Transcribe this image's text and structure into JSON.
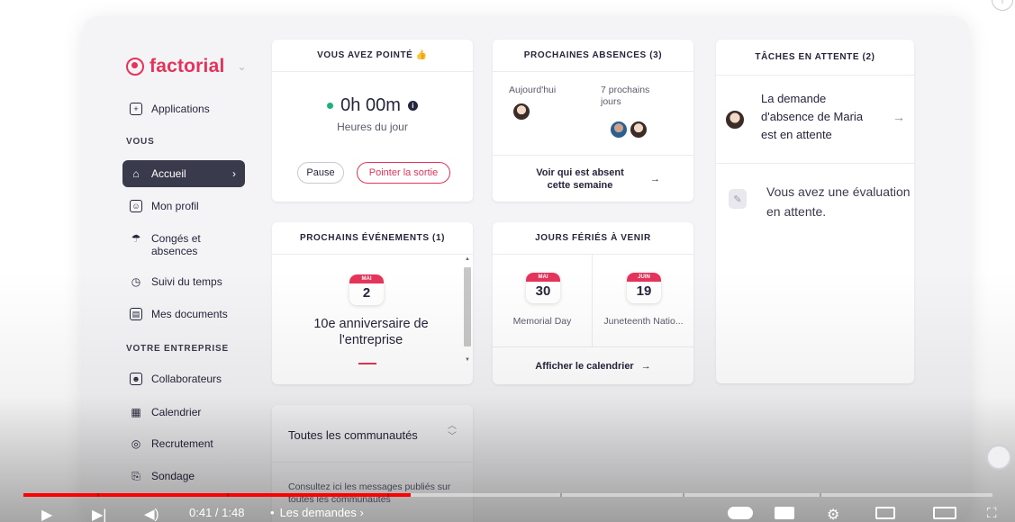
{
  "brand": {
    "name": "factorial"
  },
  "sidebar": {
    "applications": "Applications",
    "section_you": "VOUS",
    "items_you": [
      {
        "label": "Accueil",
        "icon": "home-icon",
        "active": true
      },
      {
        "label": "Mon profil",
        "icon": "profile-icon"
      },
      {
        "label": "Congés et absences",
        "icon": "beach-umbrella-icon"
      },
      {
        "label": "Suivi du temps",
        "icon": "clock-icon"
      },
      {
        "label": "Mes documents",
        "icon": "documents-icon"
      }
    ],
    "section_company": "VOTRE ENTREPRISE",
    "items_company": [
      {
        "label": "Collaborateurs",
        "icon": "people-icon"
      },
      {
        "label": "Calendrier",
        "icon": "calendar-icon"
      },
      {
        "label": "Recrutement",
        "icon": "recruitment-icon"
      },
      {
        "label": "Sondage",
        "icon": "survey-icon"
      }
    ]
  },
  "clock_card": {
    "title": "VOUS AVEZ POINTÉ 👍",
    "time": "0h 00m",
    "subtitle": "Heures du jour",
    "pause_label": "Pause",
    "clock_out_label": "Pointer la sortie"
  },
  "absences_card": {
    "title": "PROCHAINES ABSENCES (3)",
    "col_today": "Aujourd'hui",
    "col_next": "7 prochains jours",
    "link": "Voir qui est absent cette semaine"
  },
  "tasks_card": {
    "title": "TÂCHES EN ATTENTE (2)",
    "task1": "La demande d'absence de Maria est en attente",
    "task2": "Vous avez une évaluation en attente."
  },
  "events_card": {
    "title": "PROCHAINS ÉVÉNEMENTS (1)",
    "month": "MAI",
    "day": "2",
    "event": "10e anniversaire de l'entreprise"
  },
  "holidays_card": {
    "title": "JOURS FÉRIÉS À VENIR",
    "holidays": [
      {
        "month": "MAI",
        "day": "30",
        "name": "Memorial Day"
      },
      {
        "month": "JUIN",
        "day": "19",
        "name": "Juneteenth Natio..."
      }
    ],
    "link": "Afficher le calendrier"
  },
  "communities_card": {
    "title": "Toutes les communautés",
    "body": "Consultez ici les messages publiés sur toutes les communautés"
  },
  "video": {
    "time": "0:41 / 1:48",
    "chapter": "Les demandes",
    "played_fraction": 0.4,
    "accent": "#ff0000"
  },
  "colors": {
    "brand": "#e5345b",
    "active_nav": "#3a3a4d",
    "online": "#19b37b"
  }
}
